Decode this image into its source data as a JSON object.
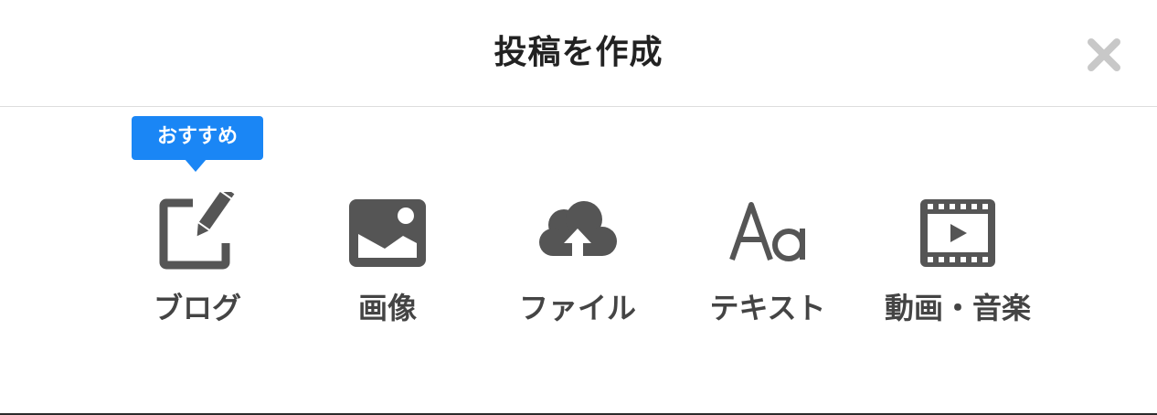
{
  "header": {
    "title": "投稿を作成"
  },
  "badge": {
    "label": "おすすめ"
  },
  "options": [
    {
      "label": "ブログ",
      "icon": "blog-edit-icon"
    },
    {
      "label": "画像",
      "icon": "image-icon"
    },
    {
      "label": "ファイル",
      "icon": "cloud-upload-icon"
    },
    {
      "label": "テキスト",
      "icon": "text-aa-icon"
    },
    {
      "label": "動画・音楽",
      "icon": "video-icon"
    }
  ],
  "colors": {
    "icon": "#555555",
    "badge": "#1a86f5",
    "close": "#c8c8c8"
  }
}
